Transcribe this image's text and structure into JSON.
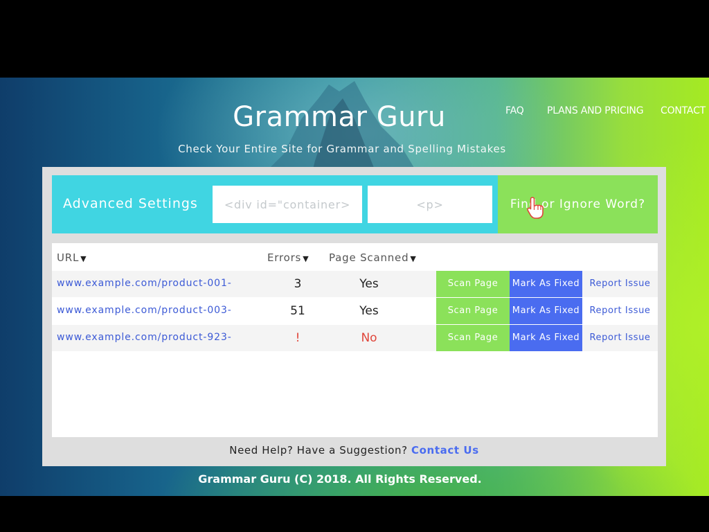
{
  "header": {
    "brand": "Grammar Guru",
    "tagline": "Check Your Entire Site for Grammar and Spelling Mistakes",
    "nav": [
      {
        "label": "FAQ"
      },
      {
        "label": "PLANS AND PRICING"
      },
      {
        "label": "CONTACT"
      }
    ]
  },
  "settings": {
    "title": "Advanced Settings",
    "container_placeholder": "<div id=\"container>",
    "tag_placeholder": "<p>",
    "find_button": "Find or Ignore Word?"
  },
  "table": {
    "columns": [
      "URL",
      "Errors",
      "Page Scanned"
    ],
    "rows": [
      {
        "url": "www.example.com/product-001-",
        "errors": "3",
        "scanned": "Yes",
        "scan": "Scan Page",
        "fixed": "Mark As Fixed",
        "report": "Report Issue"
      },
      {
        "url": "www.example.com/product-003-",
        "errors": "51",
        "scanned": "Yes",
        "scan": "Scan Page",
        "fixed": "Mark As Fixed",
        "report": "Report Issue"
      },
      {
        "url": "www.example.com/product-923-",
        "errors": "!",
        "scanned": "No",
        "scan": "Scan Page",
        "fixed": "Mark As Fixed",
        "report": "Report Issue"
      }
    ]
  },
  "help": {
    "text": "Need Help? Have a Suggestion? ",
    "link": "Contact Us"
  },
  "footer": {
    "text": "Grammar Guru (C) 2018. All Rights Reserved."
  },
  "colors": {
    "accent_cyan": "#40d5e2",
    "accent_green": "#8be15a",
    "accent_blue": "#4a6cf0",
    "error_red": "#e0453a"
  }
}
